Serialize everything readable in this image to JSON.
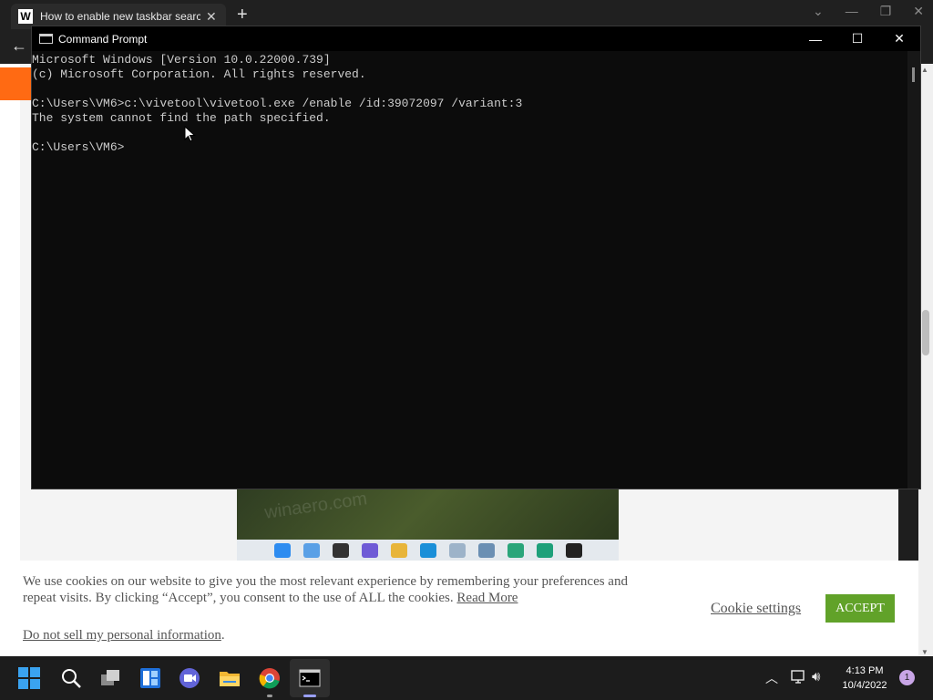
{
  "browser": {
    "tab_title": "How to enable new taskbar search",
    "tab_favicon": "W",
    "new_tab_icon": "plus-icon",
    "back_icon": "arrow-left-icon"
  },
  "cmd": {
    "title": "Command Prompt",
    "lines": [
      "Microsoft Windows [Version 10.0.22000.739]",
      "(c) Microsoft Corporation. All rights reserved.",
      "",
      "C:\\Users\\VM6>c:\\vivetool\\vivetool.exe /enable /id:39072097 /variant:3",
      "The system cannot find the path specified.",
      "",
      "C:\\Users\\VM6>"
    ]
  },
  "cookie": {
    "text": "We use cookies on our website to give you the most relevant experience by remembering your preferences and repeat visits. By clicking “Accept”, you consent to the use of ALL the cookies.",
    "read_more": "Read More",
    "do_not_sell": "Do not sell my personal information",
    "do_not_sell_suffix": ".",
    "settings": "Cookie settings",
    "accept": "ACCEPT"
  },
  "article_image": {
    "watermark": "winaero.com"
  },
  "taskbar": {
    "time": "4:13 PM",
    "date": "10/4/2022",
    "notifications": "1"
  },
  "colors": {
    "accept_green": "#61a229",
    "accent_orange": "#ff6a13",
    "start_blue": "#3aa3f0"
  }
}
